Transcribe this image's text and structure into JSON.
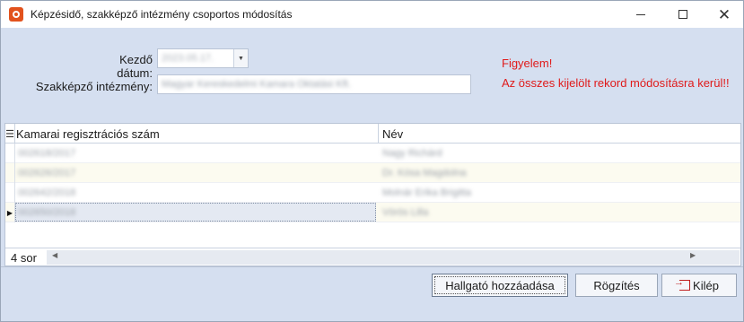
{
  "window": {
    "title": "Képzésidő, szakképző intézmény csoportos módosítás",
    "controls": {
      "minimize": "",
      "maximize": "",
      "close": "✕"
    }
  },
  "form": {
    "start_date_label": "Kezdő dátum:",
    "start_date_value": "2023.05.17.",
    "institution_label": "Szakképző intézmény:",
    "institution_value": "Magyar Kereskedelmi Kamara Oktatási Kft.",
    "warning_title": "Figyelem!",
    "warning_text": "Az  összes kijelölt rekord módosításra kerül!!"
  },
  "grid": {
    "columns": [
      "Kamarai regisztrációs szám",
      "Név"
    ],
    "rows": [
      {
        "reg": "002618/2017",
        "name": "Nagy Richárd"
      },
      {
        "reg": "002626/2017",
        "name": "Dr. Kósa Magdolna"
      },
      {
        "reg": "002642/2018",
        "name": "Molnár Erika Brigitta"
      },
      {
        "reg": "002650/2018",
        "name": "Vörös Lilla"
      }
    ],
    "row_count": "4 sor"
  },
  "buttons": {
    "add_student": "Hallgató hozzáadása",
    "save": "Rögzítés",
    "exit": "Kilép"
  },
  "colors": {
    "background": "#d5dff0",
    "warning": "#e01a1a",
    "accent_icon": "#e2521d"
  }
}
